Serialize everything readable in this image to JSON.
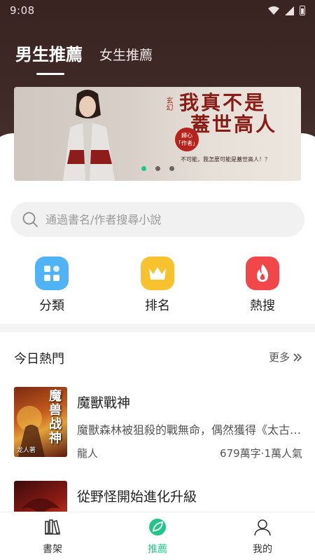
{
  "status_bar": {
    "time": "9:08"
  },
  "header": {
    "tabs": [
      {
        "label": "男生推薦",
        "active": true
      },
      {
        "label": "女生推薦",
        "active": false
      }
    ]
  },
  "banner": {
    "tag": "玄幻",
    "title_line1": "我真不是",
    "title_line2": "蓋世高人",
    "stamp": "歸心 「作者」",
    "quote": "不可能，我怎麼可能是蓋世高人！？",
    "dots": 3,
    "active_dot": 0
  },
  "search": {
    "placeholder": "通過書名/作者搜尋小說"
  },
  "quick_links": [
    {
      "label": "分類",
      "icon": "category-grid-icon",
      "color": "#4fb3f6"
    },
    {
      "label": "排名",
      "icon": "crown-icon",
      "color": "#f7c22e"
    },
    {
      "label": "熱搜",
      "icon": "flame-icon",
      "color": "#f2474a"
    }
  ],
  "section": {
    "title": "今日熱門",
    "more_label": "更多"
  },
  "books": [
    {
      "title": "魔獸戰神",
      "description": "魔獸森林被狙殺的戰無命，偶然獲得《太古神訣》",
      "author": "龍人",
      "stats": "679萬字·1萬人氣",
      "cover_text": "魔兽战神",
      "cover_author": "龙人著"
    },
    {
      "title": "從野怪開始進化升級"
    }
  ],
  "bottom_nav": [
    {
      "label": "書架",
      "icon": "bookshelf-icon",
      "active": false
    },
    {
      "label": "推薦",
      "icon": "recommend-leaf-icon",
      "active": true
    },
    {
      "label": "我的",
      "icon": "profile-icon",
      "active": false
    }
  ],
  "colors": {
    "accent": "#24c58a",
    "header_bg": "#3e2926"
  }
}
